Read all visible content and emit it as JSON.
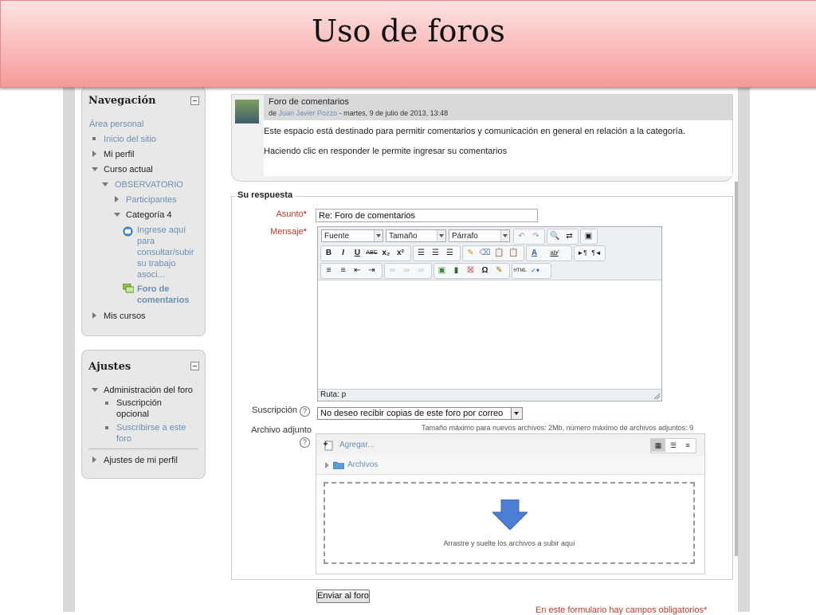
{
  "slide": {
    "title": "Uso de foros"
  },
  "navigation": {
    "title": "Navegación",
    "area_personal": "Área personal",
    "inicio": "Inicio del sitio",
    "mi_perfil": "Mi perfil",
    "curso_actual": "Curso actual",
    "observatorio": "OBSERVATORIO",
    "participantes": "Participantes",
    "categoria": "Categoría 4",
    "ingrese_lines": [
      "Ingrese aquí",
      "para",
      "consultar/subir",
      "su trabajo",
      "asoci..."
    ],
    "foro_lines": [
      "Foro de",
      "comentarios"
    ],
    "mis_cursos": "Mis cursos"
  },
  "settings": {
    "title": "Ajustes",
    "admin_foro": "Administración del foro",
    "suscripcion_lines": [
      "Suscripción",
      "opcional"
    ],
    "suscribirse_lines": [
      "Suscribirse a este",
      "foro"
    ],
    "ajustes_perfil": "Ajustes de mi perfil"
  },
  "post": {
    "subject": "Foro de comentarios",
    "meta_prefix": "de",
    "author": "Juan Javier Pozzo",
    "meta_date": "- martes, 9 de julio de 2013, 13:48",
    "line1": "Este espacio está destinado para permitir comentarios y comunicación en general en relación a la categoría.",
    "line2": "Haciendo clic en responder le permite ingresar su comentarios"
  },
  "form": {
    "legend": "Su respuesta",
    "asunto_label": "Asunto",
    "asunto_value": "Re: Foro de comentarios",
    "mensaje_label": "Mensaje",
    "required_mark": "*",
    "editor": {
      "font": "Fuente",
      "size": "Tamaño",
      "paragraph": "Párrafo",
      "path": "Ruta: p"
    },
    "suscripcion_label": "Suscripción",
    "suscripcion_value": "No deseo recibir copias de este foro por correo",
    "adjunto_label": "Archivo adjunto",
    "max_size": "Tamaño máximo para nuevos archivos: 2Mb, número máximo de archivos adjuntos: 9",
    "agregar": "Agregar...",
    "archivos": "Archivos",
    "drop_text": "Arrastre y suelte los archivos a subir aquí",
    "submit": "Enviar al foro",
    "required_note": "En este formulario hay campos obligatorios"
  },
  "colors": {
    "header_top": "#fde3e3",
    "header_bottom": "#f59a9a",
    "link": "#6a8fb5",
    "required": "#cc0000",
    "drop_arrow": "#4a7fd4"
  },
  "icons": [
    "collapse-icon",
    "page-icon",
    "forum-icon",
    "help-icon",
    "add-file-icon",
    "folder-icon",
    "download-arrow-icon",
    "view-icons-icon",
    "view-list-icon",
    "view-tree-icon"
  ]
}
